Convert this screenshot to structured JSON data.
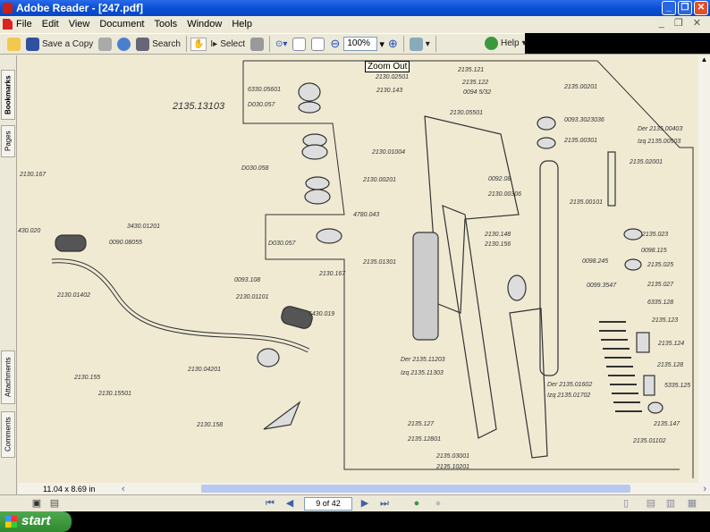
{
  "window": {
    "title": "Adobe Reader - [247.pdf]",
    "minimize": "_",
    "restore": "❐",
    "close": "✕"
  },
  "menu": [
    "File",
    "Edit",
    "View",
    "Document",
    "Tools",
    "Window",
    "Help"
  ],
  "toolbar": {
    "save_copy": "Save a Copy",
    "search": "Search",
    "select": "Select",
    "zoom": "100%",
    "help": "Help",
    "tooltip": "Zoom Out"
  },
  "nav_tabs": [
    "Bookmarks",
    "Pages",
    "Attachments",
    "Comments"
  ],
  "status": {
    "page_size": "11.04 x 8.69 in",
    "page": "9 of 42"
  },
  "taskbar": {
    "start": "start"
  },
  "colors": {
    "titlebar": "#0a4fd6",
    "paper": "#f0ead3",
    "ink": "#333333"
  },
  "diagram": {
    "main_label": "2135.13103",
    "labels": [
      "6330.05601",
      "D030.057",
      "D030.058",
      "D030.057",
      "2130.167",
      "430.020",
      "3430.01201",
      "0090.08055",
      "0093.108",
      "2130.01402",
      "2130.01101",
      "2130.167",
      "5430.019",
      "2130.155",
      "2130.15501",
      "2130.04201",
      "2130.158",
      "2130.02501",
      "2130.143",
      "2135.121",
      "2135.122",
      "0094 5/32",
      "2135.00201",
      "2130.05501",
      "0093.3023036",
      "2135.00301",
      "Der 2135.00403",
      "Izq 2135.00503",
      "2130.01004",
      "2135.02001",
      "2130.00201",
      "0092.08",
      "2130.00306",
      "2135.00101",
      "4780.043",
      "2130.148",
      "2130.156",
      "2135.023",
      "0098.115",
      "2135.025",
      "2135.01301",
      "0098.245",
      "0099.3547",
      "2135.027",
      "6335.128",
      "2135.123",
      "2135.124",
      "2135.128",
      "5335.125",
      "Der 2135.11203",
      "Izq 2135.11303",
      "Der 2135.01602",
      "Izq 2135.01702",
      "2135.147",
      "2135.01102",
      "2135.127",
      "2135.12801",
      "2135.03001",
      "2135.10201"
    ]
  }
}
